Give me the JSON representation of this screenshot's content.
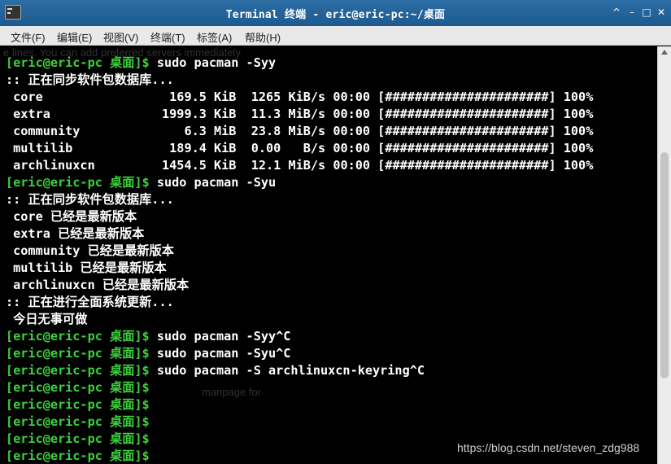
{
  "window": {
    "title": "Terminal 终端 - eric@eric-pc:~/桌面",
    "buttons": [
      "^",
      "–",
      "□",
      "✕"
    ]
  },
  "menu": [
    "文件(F)",
    "编辑(E)",
    "视图(V)",
    "终端(T)",
    "标签(A)",
    "帮助(H)"
  ],
  "terminal": {
    "lines": [
      {
        "prompt": "[eric@eric-pc 桌面]$",
        "text": " sudo pacman -Syy"
      },
      {
        "prompt": "",
        "text": ":: 正在同步软件包数据库..."
      },
      {
        "prompt": "",
        "text": " core                 169.5 KiB  1265 KiB/s 00:00 [######################] 100%"
      },
      {
        "prompt": "",
        "text": " extra               1999.3 KiB  11.3 MiB/s 00:00 [######################] 100%"
      },
      {
        "prompt": "",
        "text": " community              6.3 MiB  23.8 MiB/s 00:00 [######################] 100%"
      },
      {
        "prompt": "",
        "text": " multilib             189.4 KiB  0.00   B/s 00:00 [######################] 100%"
      },
      {
        "prompt": "",
        "text": " archlinuxcn         1454.5 KiB  12.1 MiB/s 00:00 [######################] 100%"
      },
      {
        "prompt": "[eric@eric-pc 桌面]$",
        "text": " sudo pacman -Syu"
      },
      {
        "prompt": "",
        "text": ":: 正在同步软件包数据库..."
      },
      {
        "prompt": "",
        "text": " core 已经是最新版本"
      },
      {
        "prompt": "",
        "text": " extra 已经是最新版本"
      },
      {
        "prompt": "",
        "text": " community 已经是最新版本"
      },
      {
        "prompt": "",
        "text": " multilib 已经是最新版本"
      },
      {
        "prompt": "",
        "text": " archlinuxcn 已经是最新版本"
      },
      {
        "prompt": "",
        "text": ":: 正在进行全面系统更新..."
      },
      {
        "prompt": "",
        "text": " 今日无事可做"
      },
      {
        "prompt": "[eric@eric-pc 桌面]$",
        "text": " sudo pacman -Syy^C"
      },
      {
        "prompt": "[eric@eric-pc 桌面]$",
        "text": " sudo pacman -Syu^C"
      },
      {
        "prompt": "[eric@eric-pc 桌面]$",
        "text": " sudo pacman -S archlinuxcn-keyring^C"
      },
      {
        "prompt": "[eric@eric-pc 桌面]$",
        "text": ""
      },
      {
        "prompt": "[eric@eric-pc 桌面]$",
        "text": ""
      },
      {
        "prompt": "[eric@eric-pc 桌面]$",
        "text": ""
      },
      {
        "prompt": "[eric@eric-pc 桌面]$",
        "text": ""
      },
      {
        "prompt": "[eric@eric-pc 桌面]$",
        "text": ""
      }
    ],
    "ghost_text": [
      "e lines. You can add preferred servers immediately",
      "manpage for"
    ]
  },
  "watermark": "https://blog.csdn.net/steven_zdg988",
  "colors": {
    "prompt": "#3cd23c",
    "titlebar": "#1d5a90",
    "background": "#000000"
  }
}
